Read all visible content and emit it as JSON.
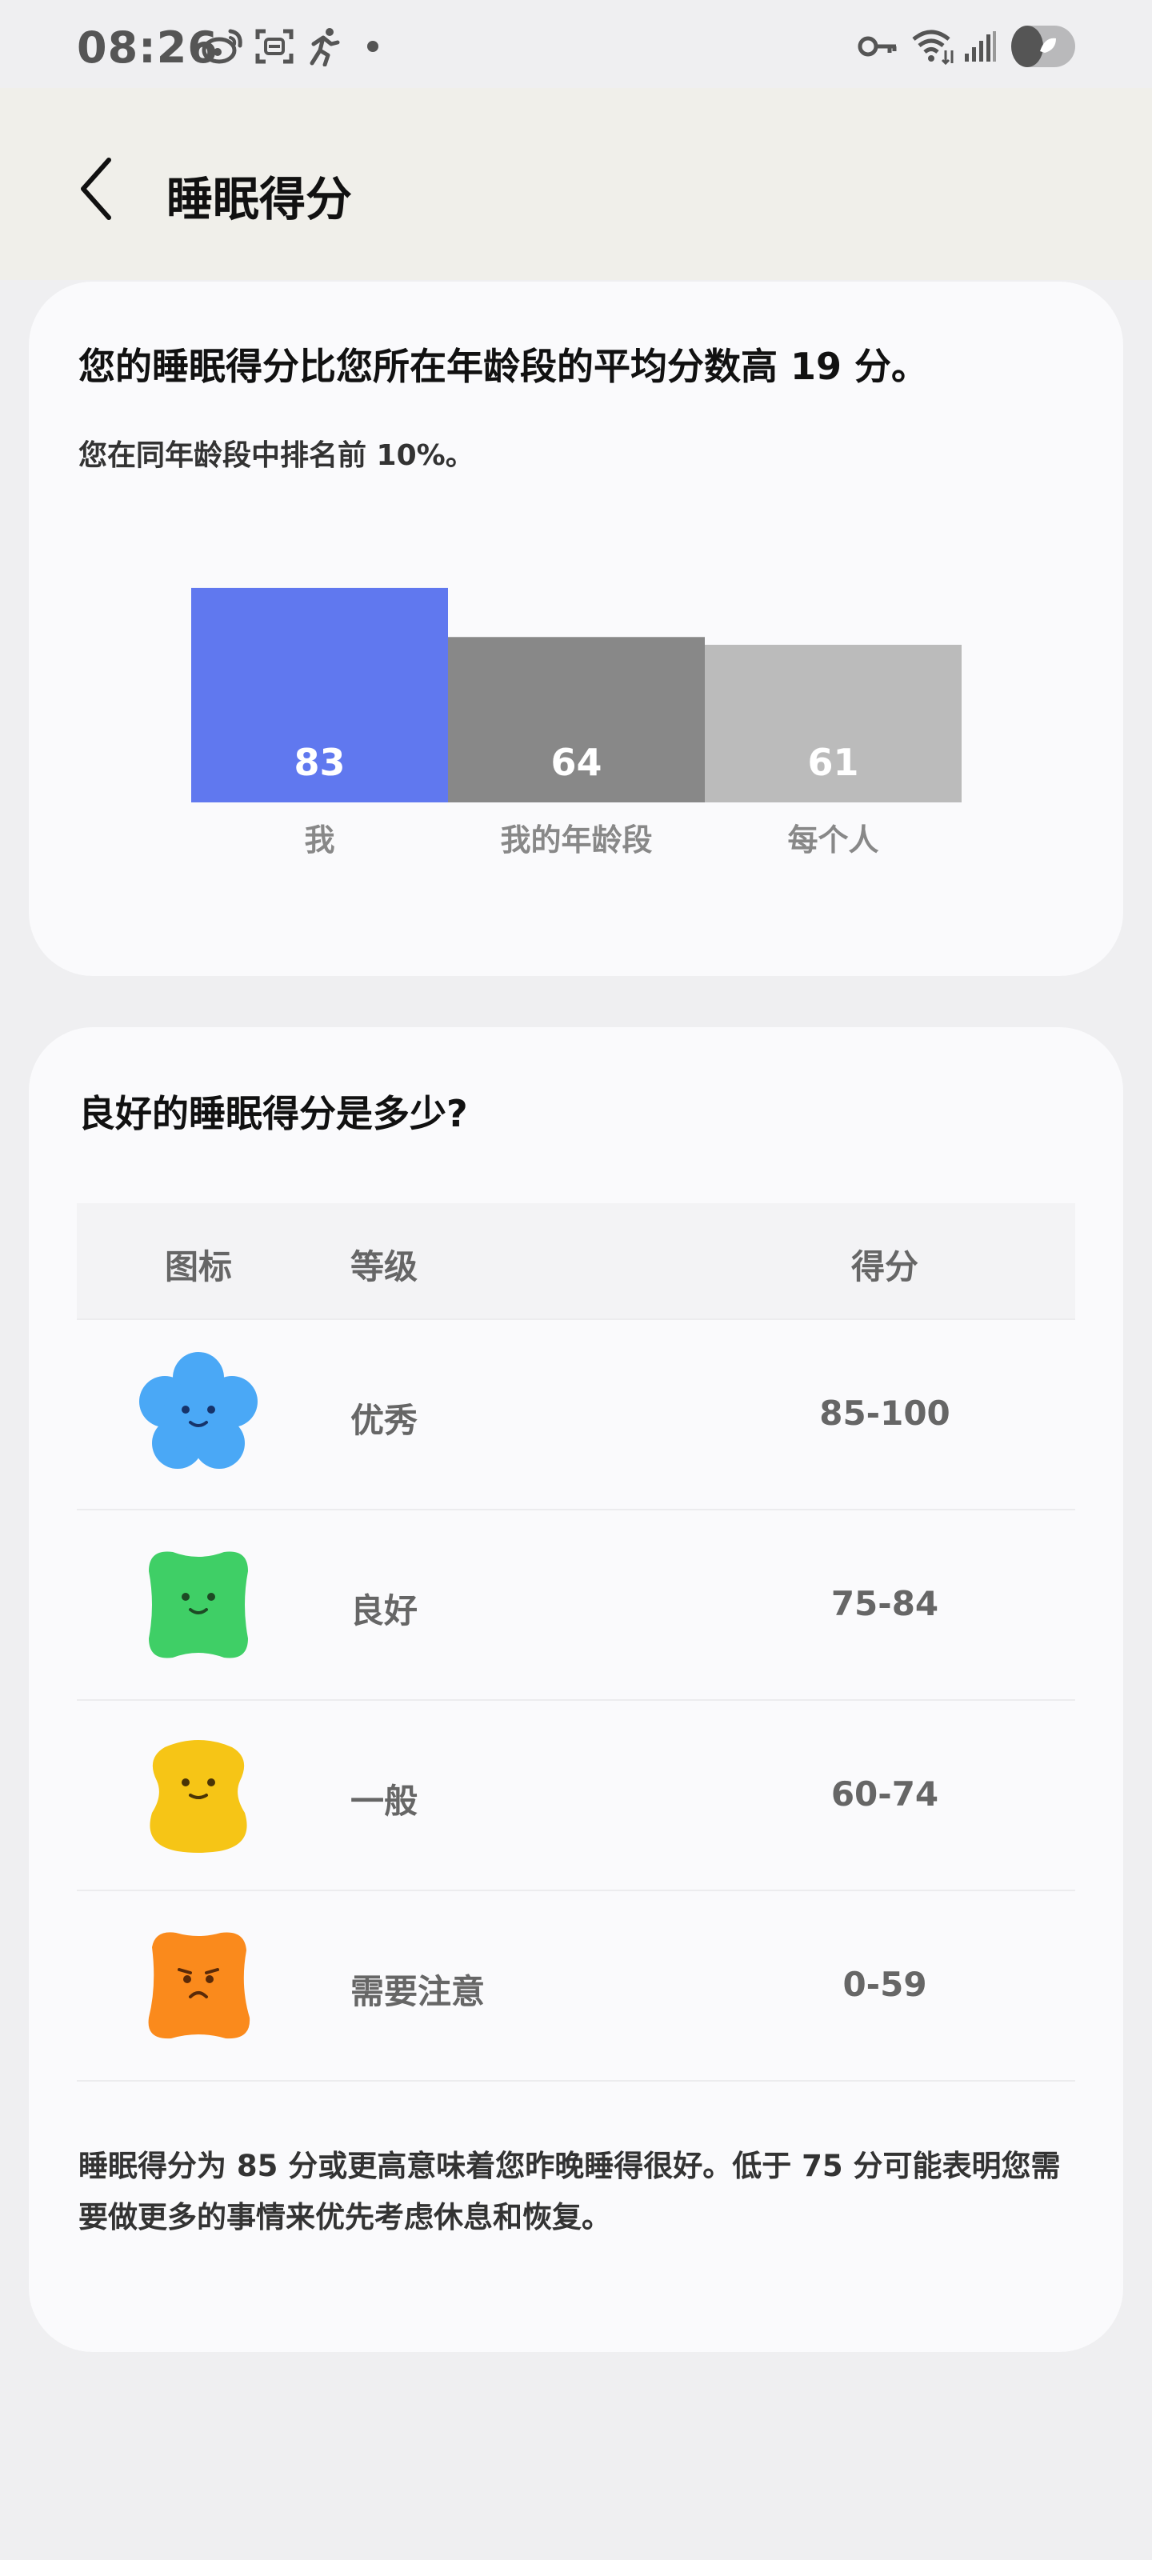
{
  "status_bar": {
    "time": "08:26",
    "left_icons": [
      "weibo-icon",
      "scan-icon",
      "running-icon",
      "dot-icon"
    ],
    "right_icons": [
      "key-icon",
      "wifi-icon",
      "signal-icon",
      "battery-icon"
    ]
  },
  "header": {
    "title": "睡眠得分"
  },
  "comparison": {
    "headline": "您的睡眠得分比您所在年龄段的平均分数高 19 分。",
    "subline": "您在同年龄段中排名前 10%。"
  },
  "chart_data": {
    "type": "bar",
    "categories": [
      "我",
      "我的年龄段",
      "每个人"
    ],
    "values": [
      83,
      64,
      61
    ],
    "colors": [
      "#6078ef",
      "#888888",
      "#bbbbbb"
    ]
  },
  "guide": {
    "title": "良好的睡眠得分是多少?",
    "columns": [
      "图标",
      "等级",
      "得分"
    ],
    "rows": [
      {
        "icon": "blue-flower-face-icon",
        "level": "优秀",
        "score": "85-100",
        "color": "#4aa8f6"
      },
      {
        "icon": "green-blob-face-icon",
        "level": "良好",
        "score": "75-84",
        "color": "#3fcf66"
      },
      {
        "icon": "yellow-blob-face-icon",
        "level": "一般",
        "score": "60-74",
        "color": "#f6c516"
      },
      {
        "icon": "orange-blob-sad-icon",
        "level": "需要注意",
        "score": "0-59",
        "color": "#fa8a1c"
      }
    ],
    "note": "睡眠得分为 85 分或更高意味着您昨晚睡得很好。低于 75 分可能表明您需要做更多的事情来优先考虑休息和恢复。"
  }
}
